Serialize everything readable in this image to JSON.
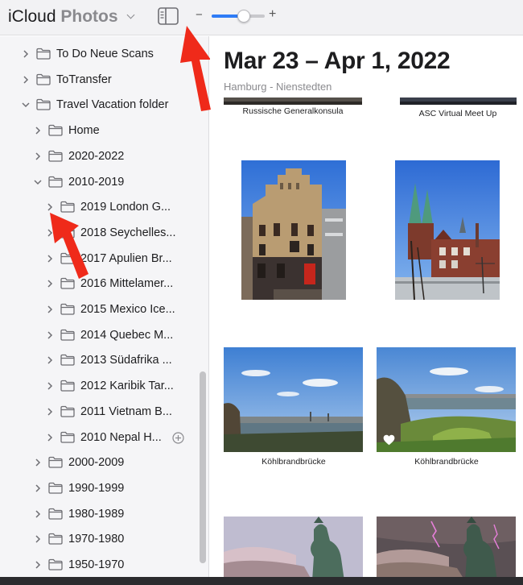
{
  "app": {
    "brand": "iCloud",
    "product": "Photos"
  },
  "zoom": {
    "minus": "−",
    "plus": "+",
    "level": 0.6
  },
  "sidebar": {
    "items": [
      {
        "label": "To Do Neue Scans",
        "depth": 0,
        "expanded": false,
        "add": false
      },
      {
        "label": "ToTransfer",
        "depth": 0,
        "expanded": false,
        "add": false
      },
      {
        "label": "Travel Vacation folder",
        "depth": 0,
        "expanded": true,
        "add": false
      },
      {
        "label": "Home",
        "depth": 1,
        "expanded": false,
        "add": false
      },
      {
        "label": "2020-2022",
        "depth": 1,
        "expanded": false,
        "add": false
      },
      {
        "label": "2010-2019",
        "depth": 1,
        "expanded": true,
        "add": false
      },
      {
        "label": "2019 London G...",
        "depth": 2,
        "expanded": false,
        "add": false
      },
      {
        "label": "2018 Seychelles...",
        "depth": 2,
        "expanded": false,
        "add": false
      },
      {
        "label": "2017 Apulien Br...",
        "depth": 2,
        "expanded": false,
        "add": false
      },
      {
        "label": "2016 Mittelamer...",
        "depth": 2,
        "expanded": false,
        "add": false
      },
      {
        "label": "2015 Mexico Ice...",
        "depth": 2,
        "expanded": false,
        "add": false
      },
      {
        "label": "2014 Quebec M...",
        "depth": 2,
        "expanded": false,
        "add": false
      },
      {
        "label": "2013 Südafrika ...",
        "depth": 2,
        "expanded": false,
        "add": false
      },
      {
        "label": "2012 Karibik Tar...",
        "depth": 2,
        "expanded": false,
        "add": false
      },
      {
        "label": "2011 Vietnam B...",
        "depth": 2,
        "expanded": false,
        "add": false
      },
      {
        "label": "2010 Nepal H...",
        "depth": 2,
        "expanded": false,
        "add": true
      },
      {
        "label": "2000-2009",
        "depth": 1,
        "expanded": false,
        "add": false
      },
      {
        "label": "1990-1999",
        "depth": 1,
        "expanded": false,
        "add": false
      },
      {
        "label": "1980-1989",
        "depth": 1,
        "expanded": false,
        "add": false
      },
      {
        "label": "1970-1980",
        "depth": 1,
        "expanded": false,
        "add": false
      },
      {
        "label": "1950-1970",
        "depth": 1,
        "expanded": false,
        "add": false
      }
    ]
  },
  "content": {
    "date_range": "Mar 23 – Apr 1, 2022",
    "location": "Hamburg - Nienstedten",
    "captions": {
      "top_left": "Russische Generalkonsula",
      "top_right": "ASC Virtual Meet Up",
      "river_left": "Köhlbrandbrücke",
      "river_right": "Köhlbrandbrücke"
    }
  },
  "colors": {
    "accent": "#2f7cf6",
    "arrow": "#ef2a1a",
    "sidebar_bg": "#f5f5f7"
  }
}
